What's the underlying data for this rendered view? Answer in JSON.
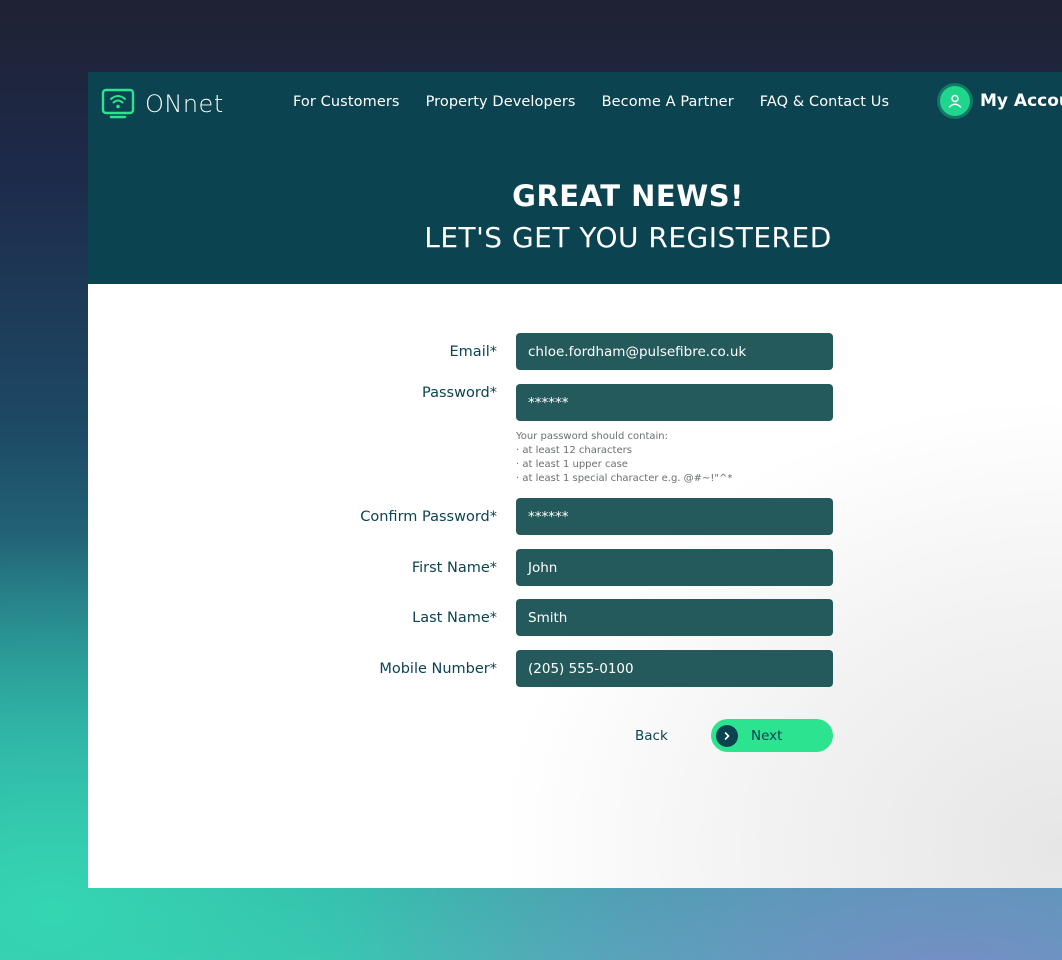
{
  "brand": {
    "name": "ONnet",
    "logo_icon": "wifi-tv-icon"
  },
  "nav": {
    "items": [
      {
        "label": "For Customers"
      },
      {
        "label": "Property Developers"
      },
      {
        "label": "Become A Partner"
      },
      {
        "label": "FAQ & Contact Us"
      }
    ],
    "account_label": "My Account",
    "account_icon": "user-icon"
  },
  "hero": {
    "line1": "GREAT NEWS!",
    "line2": "LET'S GET YOU REGISTERED"
  },
  "form": {
    "email": {
      "label": "Email*",
      "value": "chloe.fordham@pulsefibre.co.uk"
    },
    "password": {
      "label": "Password*",
      "value": "******"
    },
    "password_hint": {
      "title": "Your password should contain:",
      "rules": [
        "· at least 12 characters",
        "· at least 1 upper case",
        "· at least 1 special character e.g. @#~!\"^*"
      ]
    },
    "confirm_password": {
      "label": "Confirm Password*",
      "value": "******"
    },
    "first_name": {
      "label": "First Name*",
      "value": "John"
    },
    "last_name": {
      "label": "Last Name*",
      "value": "Smith"
    },
    "mobile": {
      "label": "Mobile Number*",
      "value": "(205) 555-0100"
    }
  },
  "actions": {
    "back_label": "Back",
    "next_label": "Next",
    "next_icon": "chevron-right-icon"
  },
  "colors": {
    "header_bg": "#0b4450",
    "field_bg": "#255a5c",
    "accent": "#2ce38f",
    "text_dark": "#0b4450"
  }
}
